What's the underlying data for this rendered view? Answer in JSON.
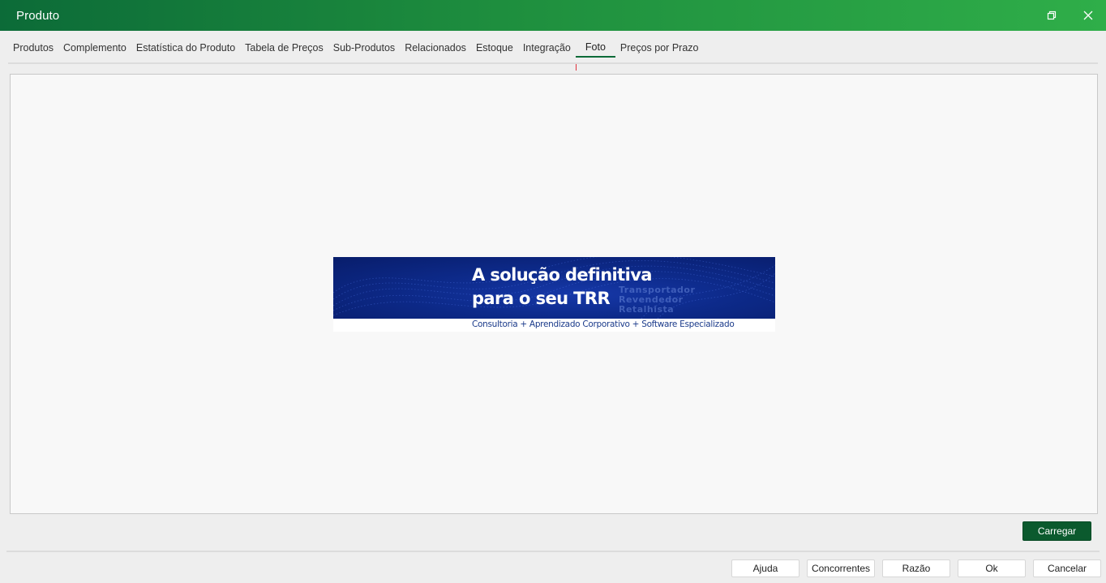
{
  "window": {
    "title": "Produto",
    "restore_icon": "restore-icon",
    "close_icon": "close-icon"
  },
  "tabs": [
    {
      "label": "Produtos",
      "active": false
    },
    {
      "label": "Complemento",
      "active": false
    },
    {
      "label": "Estatística do Produto",
      "active": false
    },
    {
      "label": "Tabela de Preços",
      "active": false
    },
    {
      "label": "Sub-Produtos",
      "active": false
    },
    {
      "label": "Relacionados",
      "active": false
    },
    {
      "label": "Estoque",
      "active": false
    },
    {
      "label": "Integração",
      "active": false
    },
    {
      "label": "Foto",
      "active": true
    },
    {
      "label": "Preços por Prazo",
      "active": false
    }
  ],
  "photo": {
    "headline_line1": "A solução definitiva",
    "headline_line2": "para o seu TRR",
    "side_line1": "Transportador",
    "side_line2": "Revendedor",
    "side_line3": "Retalhista",
    "tagline": "Consultoria + Aprendizado Corporativo + Software Especializado"
  },
  "actions": {
    "load_label": "Carregar",
    "help_label": "Ajuda",
    "competitors_label": "Concorrentes",
    "reason_label": "Razão",
    "ok_label": "Ok",
    "cancel_label": "Cancelar"
  },
  "colors": {
    "titlebar_start": "#0c6b38",
    "titlebar_end": "#2fae49",
    "primary_button": "#0b5a2e",
    "active_tab_underline": "#0c6b38",
    "banner_blue": "#0d2a8a"
  }
}
